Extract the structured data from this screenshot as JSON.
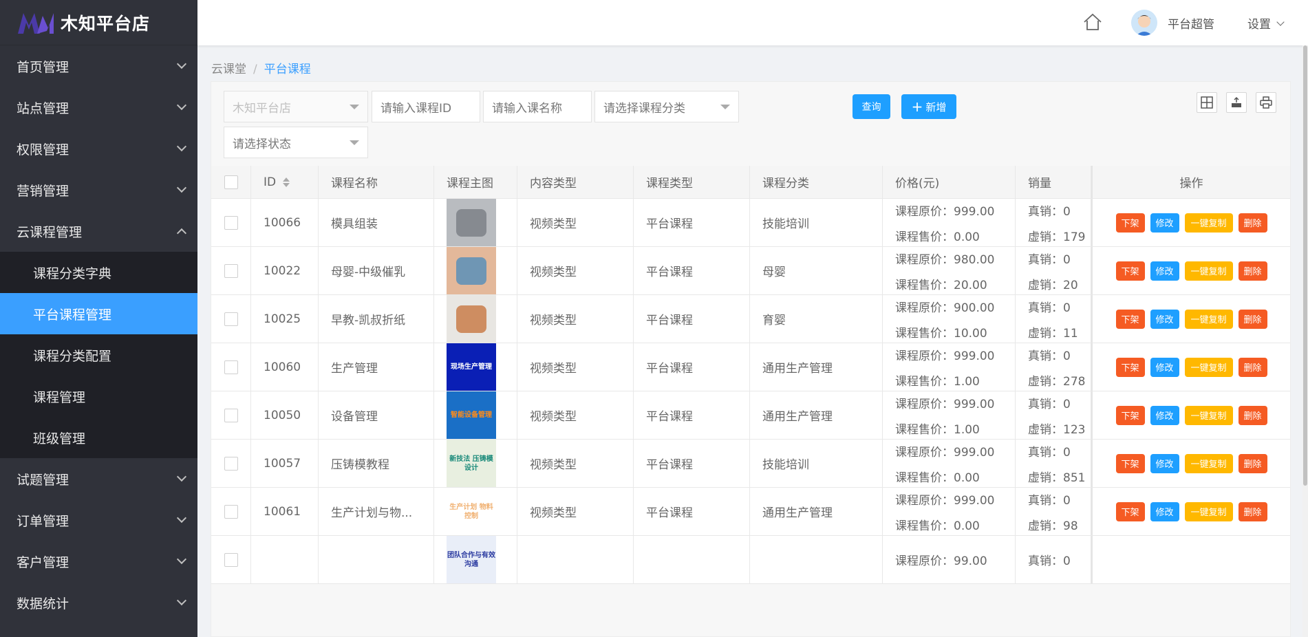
{
  "brand": {
    "name": "木知平台店"
  },
  "sidebar": {
    "items": [
      {
        "label": "首页管理",
        "expanded": false
      },
      {
        "label": "站点管理",
        "expanded": false
      },
      {
        "label": "权限管理",
        "expanded": false
      },
      {
        "label": "营销管理",
        "expanded": false
      },
      {
        "label": "云课程管理",
        "expanded": true
      },
      {
        "label": "试题管理",
        "expanded": false
      },
      {
        "label": "订单管理",
        "expanded": false
      },
      {
        "label": "客户管理",
        "expanded": false
      },
      {
        "label": "数据统计",
        "expanded": false
      }
    ],
    "sub_items": [
      {
        "label": "课程分类字典",
        "active": false
      },
      {
        "label": "平台课程管理",
        "active": true
      },
      {
        "label": "课程分类配置",
        "active": false
      },
      {
        "label": "课程管理",
        "active": false
      },
      {
        "label": "班级管理",
        "active": false
      }
    ]
  },
  "header": {
    "user_name": "平台超管",
    "settings_label": "设置"
  },
  "breadcrumb": {
    "root": "云课堂",
    "sep": "/",
    "current": "平台课程"
  },
  "filters": {
    "store": "木知平台店",
    "course_id_placeholder": "请输入课程ID",
    "course_name_placeholder": "请输入课名称",
    "category_placeholder": "请选择课程分类",
    "status_placeholder": "请选择状态",
    "query_label": "查询",
    "add_label": "新增"
  },
  "table": {
    "columns": [
      "ID",
      "课程名称",
      "课程主图",
      "内容类型",
      "课程类型",
      "课程分类",
      "价格(元)",
      "销量",
      "操作"
    ],
    "price_orig_label": "课程原价：",
    "price_sale_label": "课程售价：",
    "sales_real_label": "真销：",
    "sales_virtual_label": "虚销：",
    "ops": {
      "off": "下架",
      "edit": "修改",
      "copy": "一键复制",
      "delete": "删除"
    },
    "rows": [
      {
        "id": "10066",
        "name": "模具组装",
        "content_type": "视频类型",
        "course_type": "平台课程",
        "category": "技能培训",
        "orig": "999.00",
        "sale": "0.00",
        "real": "0",
        "virtual": "179",
        "img_color": "#b9bcc0",
        "img_accent": "#7d8187"
      },
      {
        "id": "10022",
        "name": "母婴-中级催乳",
        "content_type": "视频类型",
        "course_type": "平台课程",
        "category": "母婴",
        "orig": "980.00",
        "sale": "20.00",
        "real": "0",
        "virtual": "20",
        "img_color": "#e3b89a",
        "img_accent": "#5b8fb8"
      },
      {
        "id": "10025",
        "name": "早教-凯叔折纸",
        "content_type": "视频类型",
        "course_type": "平台课程",
        "category": "育婴",
        "orig": "900.00",
        "sale": "10.00",
        "real": "0",
        "virtual": "11",
        "img_color": "#e8e6e2",
        "img_accent": "#c97d4a"
      },
      {
        "id": "10060",
        "name": "生产管理",
        "content_type": "视频类型",
        "course_type": "平台课程",
        "category": "通用生产管理",
        "orig": "999.00",
        "sale": "1.00",
        "real": "0",
        "virtual": "278",
        "img_color": "#0a1fb5",
        "img_accent": "#ffffff",
        "img_text": "现场生产管理"
      },
      {
        "id": "10050",
        "name": "设备管理",
        "content_type": "视频类型",
        "course_type": "平台课程",
        "category": "通用生产管理",
        "orig": "999.00",
        "sale": "1.00",
        "real": "0",
        "virtual": "123",
        "img_color": "#1a6fc6",
        "img_accent": "#ff8c1a",
        "img_text": "智能设备管理"
      },
      {
        "id": "10057",
        "name": "压铸模教程",
        "content_type": "视频类型",
        "course_type": "平台课程",
        "category": "技能培训",
        "orig": "999.00",
        "sale": "0.00",
        "real": "0",
        "virtual": "851",
        "img_color": "#e8efe0",
        "img_accent": "#1a8a7a",
        "img_text": "新技法 压铸模设计"
      },
      {
        "id": "10061",
        "name": "生产计划与物...",
        "content_type": "视频类型",
        "course_type": "平台课程",
        "category": "通用生产管理",
        "orig": "999.00",
        "sale": "0.00",
        "real": "0",
        "virtual": "98",
        "img_color": "#ffffff",
        "img_accent": "#f0b070",
        "img_text": "生产计划 物料控制"
      },
      {
        "id": "",
        "name": "",
        "content_type": "",
        "course_type": "",
        "category": "",
        "orig": "99.00",
        "sale": "",
        "real": "0",
        "virtual": "",
        "img_color": "#e9eef8",
        "img_accent": "#2a3aa0",
        "img_text": "团队合作与有效沟通"
      }
    ]
  },
  "colors": {
    "sidebar_bg": "#30323a",
    "submenu_bg": "#1f2026",
    "active": "#3a9fff",
    "blue_btn": "#1e9fff",
    "orange_btn": "#f55b23",
    "yellow_btn": "#ffb800"
  }
}
